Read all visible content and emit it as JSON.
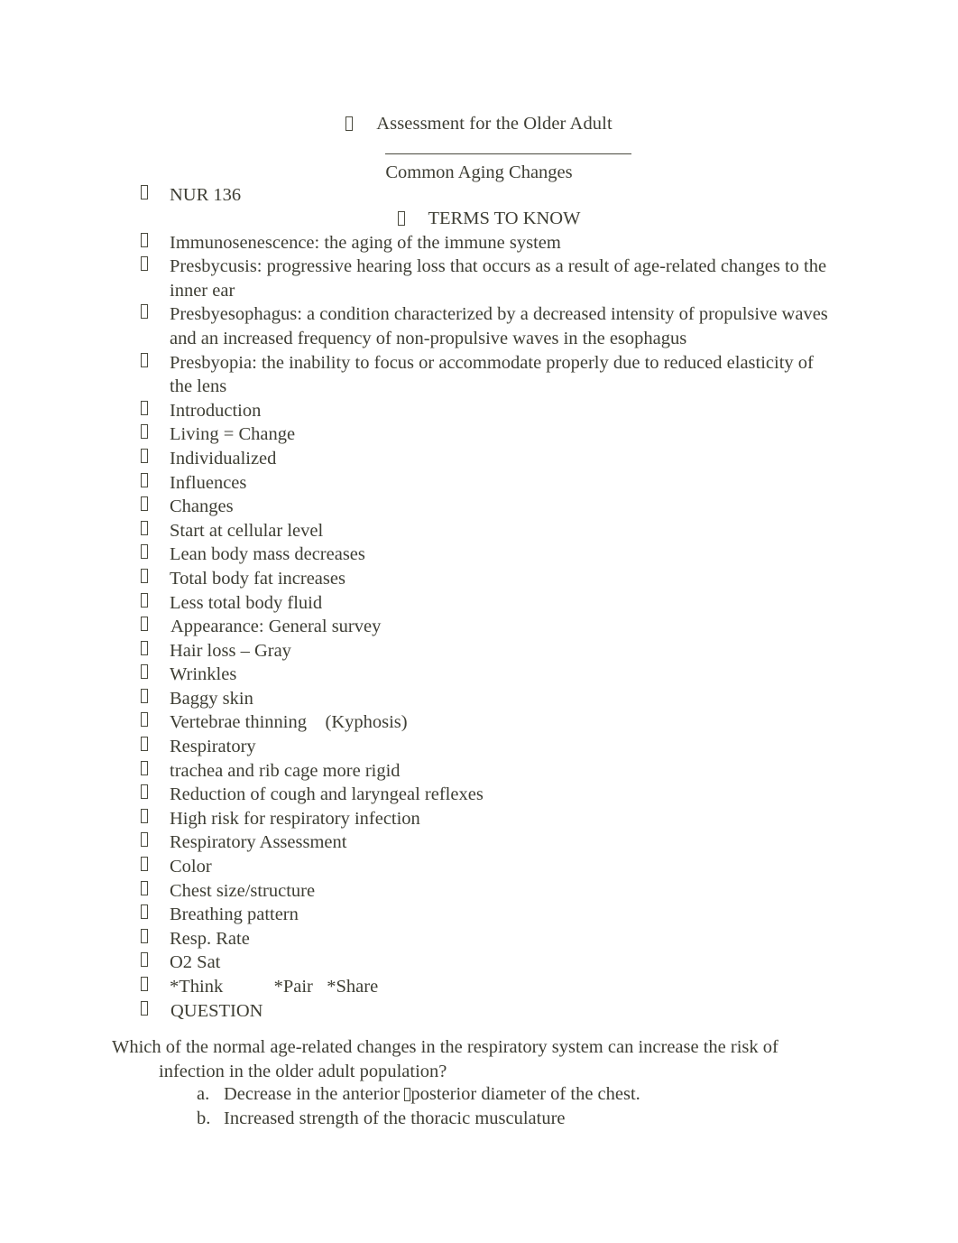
{
  "document": {
    "header": {
      "title": "Assessment for the Older Adult",
      "subtitle": "Common Aging Changes",
      "course": "NUR 136",
      "section_heading": "TERMS TO KNOW"
    },
    "bullets": [
      {
        "text": "Immunosenescence: the aging of the immune system"
      },
      {
        "text": "Presbycusis: progressive hearing loss that occurs as a result of age-related changes to the inner ear"
      },
      {
        "text": "Presbyesophagus: a condition characterized by a decreased intensity of propulsive waves and an increased frequency of non-propulsive waves in the esophagus"
      },
      {
        "text": "Presbyopia: the inability to focus or accommodate properly due to reduced elasticity of the lens"
      },
      {
        "text": "Introduction"
      },
      {
        "text": "Living = Change"
      },
      {
        "text": "Individualized"
      },
      {
        "text": "Influences"
      },
      {
        "text": "Changes"
      },
      {
        "text": "Start at cellular level"
      },
      {
        "text": "Lean body mass decreases"
      },
      {
        "text": "Total body fat increases"
      },
      {
        "text": "Less total body fluid"
      },
      {
        "text": "Appearance:  General survey"
      },
      {
        "text": "Hair loss – Gray"
      },
      {
        "text": "Wrinkles"
      },
      {
        "text": "Baggy skin"
      },
      {
        "text": "Vertebrae thinning    (Kyphosis)"
      },
      {
        "text": "Respiratory"
      },
      {
        "text": "trachea and rib cage more rigid"
      },
      {
        "text": "Reduction of cough and laryngeal reflexes"
      },
      {
        "text": "High risk for respiratory infection"
      },
      {
        "text": "Respiratory Assessment"
      },
      {
        "text": "Color"
      },
      {
        "text": "Chest size/structure"
      },
      {
        "text": "Breathing pattern"
      },
      {
        "text": "Resp. Rate"
      },
      {
        "text": "O2 Sat"
      },
      {
        "text": "*Think           *Pair   *Share"
      },
      {
        "text": "QUESTION"
      }
    ],
    "question": {
      "line1": "Which of the normal age-related changes in the respiratory system can increase the risk of",
      "line2": "infection in the older adult population?",
      "choices": [
        {
          "marker": "a.",
          "before": "Decrease in the anterior ",
          "after": "posterior diameter of the chest."
        },
        {
          "marker": "b.",
          "before": "Increased strength of the thoracic musculature",
          "after": ""
        }
      ]
    },
    "colors": {
      "text": "#3e3e34",
      "rule": "#4a4a3e",
      "background": "#ffffff"
    }
  }
}
